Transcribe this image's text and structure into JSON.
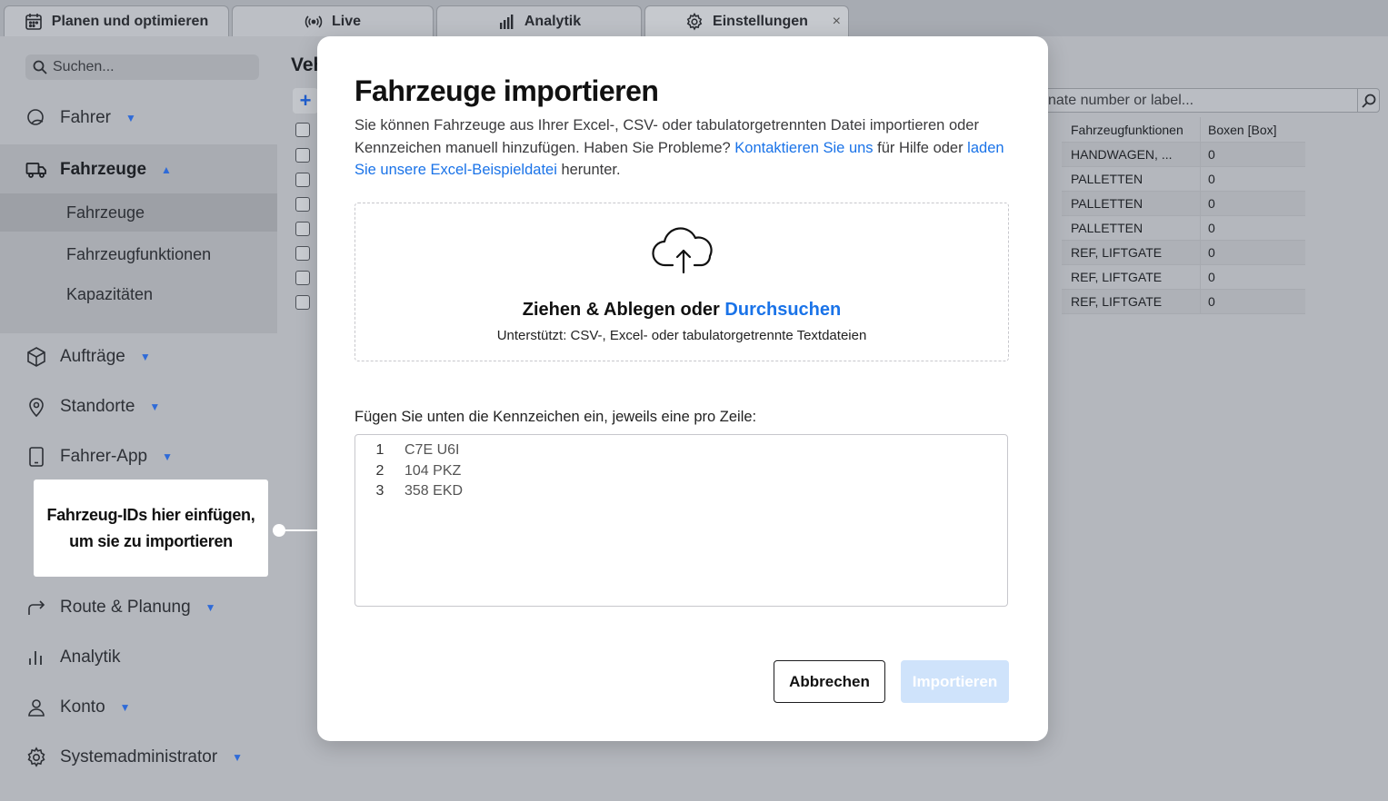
{
  "tabs": [
    {
      "label": "Planen und optimieren",
      "icon": "calendar-icon"
    },
    {
      "label": "Live",
      "icon": "broadcast-icon"
    },
    {
      "label": "Analytik",
      "icon": "bar-chart-icon"
    },
    {
      "label": "Einstellungen",
      "icon": "gear-icon",
      "close": "×"
    }
  ],
  "sidebar": {
    "search_placeholder": "Suchen...",
    "fahrer": "Fahrer",
    "fahrzeuge": "Fahrzeuge",
    "sub": [
      "Fahrzeuge",
      "Fahrzeugfunktionen",
      "Kapazitäten"
    ],
    "auftraege": "Aufträge",
    "standorte": "Standorte",
    "fahrer_app": "Fahrer-App",
    "route": "Route & Planung",
    "analytik": "Analytik",
    "konto": "Konto",
    "sysadmin": "Systemadministrator",
    "caret_down": "▼",
    "caret_up": "▲"
  },
  "main": {
    "title": "Veh",
    "plus": "+",
    "search_placeholder": "nate number or label...",
    "table": {
      "headers": [
        "Fahrzeugfunktionen",
        "Boxen [Box]"
      ],
      "rows": [
        [
          "HANDWAGEN, ...",
          "0"
        ],
        [
          "PALLETTEN",
          "0"
        ],
        [
          "PALLETTEN",
          "0"
        ],
        [
          "PALLETTEN",
          "0"
        ],
        [
          "REF, LIFTGATE",
          "0"
        ],
        [
          "REF, LIFTGATE",
          "0"
        ],
        [
          "REF, LIFTGATE",
          "0"
        ]
      ]
    }
  },
  "callout": {
    "line1": "Fahrzeug-IDs hier einfügen,",
    "line2": "um sie zu importieren"
  },
  "modal": {
    "title": "Fahrzeuge importieren",
    "desc_part1": "Sie können Fahrzeuge aus Ihrer Excel-, CSV- oder tabulatorgetrennten Datei importieren oder Kennzeichen manuell hinzufügen. Haben Sie Probleme? ",
    "link_contact": "Kontaktieren Sie uns",
    "desc_part2": " für Hilfe oder ",
    "link_sample": "laden Sie unsere Excel-Beispieldatei",
    "desc_part3": " herunter.",
    "dropzone_title": "Ziehen & Ablegen oder ",
    "dropzone_link": "Durchsuchen",
    "dropzone_sub": "Unterstützt: CSV-, Excel- oder tabulatorgetrennte Textdateien",
    "paste_label": "Fügen Sie unten die Kennzeichen ein, jeweils eine pro Zeile:",
    "lines": [
      {
        "n": "1",
        "text": "C7E U6I"
      },
      {
        "n": "2",
        "text": "104 PKZ"
      },
      {
        "n": "3",
        "text": "358 EKD"
      }
    ],
    "cancel": "Abbrechen",
    "import": "Importieren"
  }
}
